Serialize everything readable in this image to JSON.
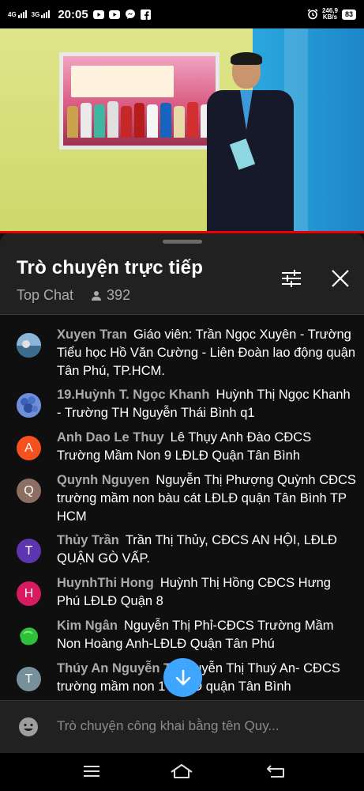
{
  "status_bar": {
    "network_1": "4G",
    "network_2": "3G",
    "time": "20:05",
    "speed_value": "246,9",
    "speed_unit": "KB/s",
    "battery": "83"
  },
  "chat": {
    "title": "Trò chuyện trực tiếp",
    "mode": "Top Chat",
    "viewer_count": "392",
    "messages": [
      {
        "author": "Xuyen Tran",
        "text": "Giáo viên: Trần Ngọc Xuyên - Trường Tiểu học Hồ Văn Cường - Liên Đoàn lao động quận Tân Phú, TP.HCM.",
        "avatar_letter": "",
        "avatar_color": "#5a7fa8"
      },
      {
        "author": "19.Huỳnh T. Ngọc Khanh",
        "text": "Huỳnh Thị Ngọc Khanh - Trường TH Nguyễn Thái Bình q1",
        "avatar_letter": "",
        "avatar_color": "#2f5bb0"
      },
      {
        "author": "Anh Dao Le Thuy",
        "text": "Lê Thụy Anh Đào CĐCS Trường Mầm Non 9 LĐLĐ Quận Tân Bình",
        "avatar_letter": "A",
        "avatar_color": "#f4511e"
      },
      {
        "author": "Quynh Nguyen",
        "text": "Nguyễn Thị Phượng Quỳnh CĐCS trường mầm non bàu cát LĐLĐ quận Tân Bình TP HCM",
        "avatar_letter": "Q",
        "avatar_color": "#8d6e63"
      },
      {
        "author": "Thủy Trần",
        "text": "Trần Thị Thủy, CĐCS AN HỘI, LĐLĐ QUẬN GÒ VẤP.",
        "avatar_letter": "T",
        "avatar_color": "#5e35b1"
      },
      {
        "author": "HuynhThi Hong",
        "text": "Huỳnh Thị Hồng CĐCS Hưng Phú LĐLĐ Quận 8",
        "avatar_letter": "H",
        "avatar_color": "#d81b60"
      },
      {
        "author": "Kim Ngân",
        "text": "Nguyễn Thị Phỉ-CĐCS Trường Mầm Non Hoàng Anh-LĐLĐ Quận Tân Phú",
        "avatar_letter": "",
        "avatar_color": "#1b8e2d"
      },
      {
        "author": "Thúy An Nguyễn T",
        "text": "Nguyễn Thị Thuý An- CĐCS trường mầm non 1 LĐLĐ quận Tân Bình",
        "avatar_letter": "T",
        "avatar_color": "#78909c"
      }
    ],
    "input_placeholder": "Trò chuyện công khai bằng tên Quy..."
  },
  "colors": {
    "accent": "#3ea6ff",
    "progress": "#ee0000",
    "panel": "#212121"
  },
  "icons": [
    "filter-icon",
    "close-icon",
    "person-icon",
    "arrow-down-icon",
    "emoji-icon",
    "menu-icon",
    "home-icon",
    "back-icon"
  ]
}
